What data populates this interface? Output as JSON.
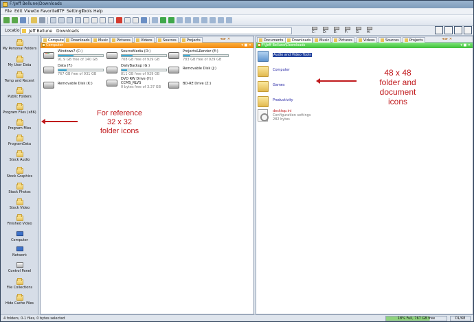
{
  "window": {
    "title": "F:\\Jeff Bellune\\Downloads"
  },
  "menu": [
    "File",
    "Edit",
    "View",
    "Go",
    "Favorites",
    "FTP",
    "Settings",
    "Tools",
    "Help"
  ],
  "location": {
    "label": "Location",
    "crumbs": [
      "Jeff Bellune",
      "Downloads"
    ],
    "drive_letters": [
      "C:",
      "D:",
      "E:",
      "F:",
      "G:",
      "H:"
    ]
  },
  "left_bar": [
    "My Personal Folders",
    "My User Data",
    "Temp and Recent",
    "Public Folders",
    "Program Files (x86)",
    "Program Files",
    "ProgramData",
    "Stock Audio",
    "Stock Graphics",
    "Stock Photos",
    "Stock Video",
    "Finished Video",
    "Computer",
    "Network",
    "Control Panel",
    "File Collections",
    "Hide Cache Files"
  ],
  "left_pane": {
    "tabs": [
      "Computer",
      "Downloads",
      "Music",
      "Pictures",
      "Videos",
      "Sources",
      "Projects"
    ],
    "path": "Computer",
    "drives": [
      {
        "name": "Windows7 (C:)",
        "free": "91.9 GB free of 140 GB",
        "used_fraction": 0.34
      },
      {
        "name": "SourceMedia (D:)",
        "free": "708 GB free of 929 GB",
        "used_fraction": 0.24
      },
      {
        "name": "Projects&Render (E:)",
        "free": "783 GB free of 929 GB",
        "used_fraction": 0.16
      },
      {
        "name": "Data (F:)",
        "free": "767 GB free of 931 GB",
        "used_fraction": 0.18
      },
      {
        "name": "DailyBackup (G:)",
        "free": "811 GB free of 929 GB",
        "used_fraction": 0.13
      },
      {
        "name": "Removable Disk (J:)"
      },
      {
        "name": "Removable Disk (K:)"
      },
      {
        "name": "DVD RW Drive (H:)",
        "sub": "CCMS_RLVS",
        "free": "0 bytes free of 3.37 GB"
      },
      {
        "name": "BD-RE Drive (Z:)"
      }
    ]
  },
  "right_pane": {
    "tabs": [
      "Documents",
      "Downloads",
      "Music",
      "Pictures",
      "Videos",
      "Sources",
      "Projects"
    ],
    "path": "F:\\Jeff Bellune\\Downloads",
    "items": [
      {
        "name": "Audio and Video Tools",
        "type": "folder",
        "selected": true
      },
      {
        "name": "Computer",
        "type": "folder"
      },
      {
        "name": "Games",
        "type": "folder"
      },
      {
        "name": "Productivity",
        "type": "folder"
      }
    ],
    "file": {
      "name": "desktop.ini",
      "desc": "Configuration settings",
      "size": "282 bytes"
    }
  },
  "annotations": {
    "left": [
      "For reference",
      "32 x 32",
      "folder icons"
    ],
    "right": [
      "48 x 48",
      "folder and",
      "document",
      "icons"
    ]
  },
  "status": {
    "text": "4 folders, 0-1 files, 0 bytes selected",
    "disk": "18% Full, 767 GB free",
    "extra": "DL/68"
  },
  "colors": {
    "orange_path": "#f08a14",
    "green_path": "#3fbf39",
    "annotation": "#c0191c"
  }
}
